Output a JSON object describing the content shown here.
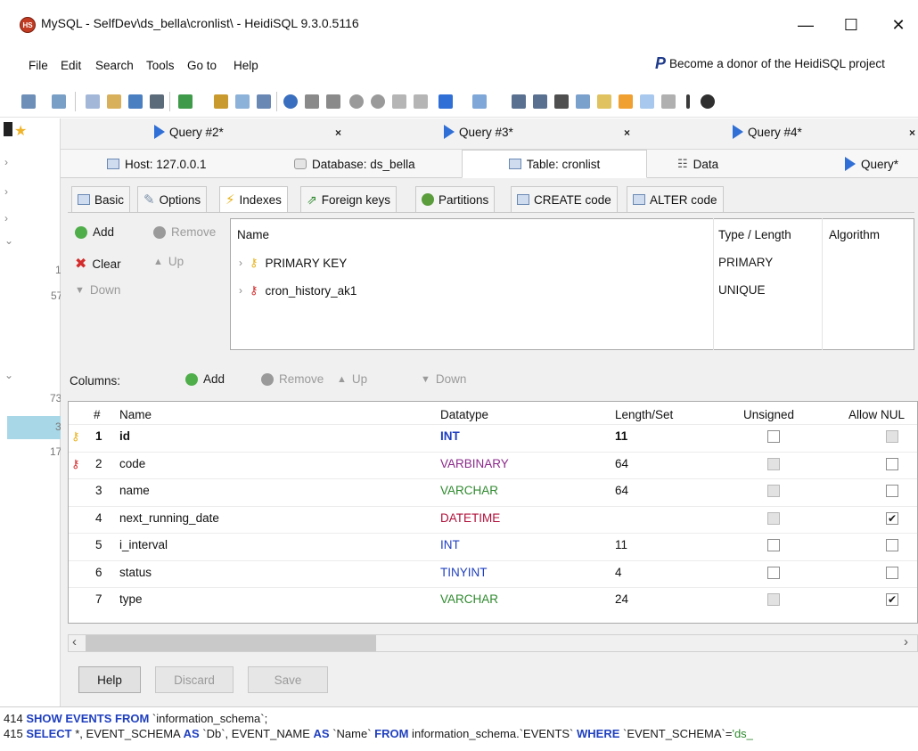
{
  "window": {
    "title": "MySQL - SelfDev\\ds_bella\\cronlist\\ - HeidiSQL 9.3.0.5116",
    "logo_text": "HS"
  },
  "menu": [
    "File",
    "Edit",
    "Search",
    "Tools",
    "Go to",
    "Help"
  ],
  "donor_text": "Become a donor of the HeidiSQL project",
  "query_tabs": [
    {
      "label": "Query #2*"
    },
    {
      "label": "Query #3*"
    },
    {
      "label": "Query #4*"
    }
  ],
  "close_glyph": "×",
  "object_tabs": [
    {
      "label": "Host: 127.0.0.1"
    },
    {
      "label": "Database: ds_bella"
    },
    {
      "label": "Table: cronlist"
    },
    {
      "label": "Data"
    },
    {
      "label": "Query*"
    }
  ],
  "sub_tabs": [
    "Basic",
    "Options",
    "Indexes",
    "Foreign keys",
    "Partitions",
    "CREATE code",
    "ALTER code"
  ],
  "index_buttons": {
    "add": "Add",
    "remove": "Remove",
    "clear": "Clear",
    "up": "Up",
    "down": "Down"
  },
  "index_headers": [
    "Name",
    "Type / Length",
    "Algorithm"
  ],
  "indexes": [
    {
      "name": "PRIMARY KEY",
      "type": "PRIMARY"
    },
    {
      "name": "cron_history_ak1",
      "type": "UNIQUE"
    }
  ],
  "columns_toolbar": {
    "label": "Columns:",
    "add": "Add",
    "remove": "Remove",
    "up": "Up",
    "down": "Down"
  },
  "grid_headers": [
    "#",
    "Name",
    "Datatype",
    "Length/Set",
    "Unsigned",
    "Allow NUL"
  ],
  "columns": [
    {
      "num": "1",
      "name": "id",
      "datatype": "INT",
      "length": "11",
      "unsigned": "empty",
      "allow_null": "disabled"
    },
    {
      "num": "2",
      "name": "code",
      "datatype": "VARBINARY",
      "length": "64",
      "unsigned": "disabled",
      "allow_null": "empty"
    },
    {
      "num": "3",
      "name": "name",
      "datatype": "VARCHAR",
      "length": "64",
      "unsigned": "disabled",
      "allow_null": "empty"
    },
    {
      "num": "4",
      "name": "next_running_date",
      "datatype": "DATETIME",
      "length": "",
      "unsigned": "disabled",
      "allow_null": "checked"
    },
    {
      "num": "5",
      "name": "i_interval",
      "datatype": "INT",
      "length": "11",
      "unsigned": "empty",
      "allow_null": "empty"
    },
    {
      "num": "6",
      "name": "status",
      "datatype": "TINYINT",
      "length": "4",
      "unsigned": "empty",
      "allow_null": "empty"
    },
    {
      "num": "7",
      "name": "type",
      "datatype": "VARCHAR",
      "length": "24",
      "unsigned": "disabled",
      "allow_null": "checked"
    }
  ],
  "buttons": {
    "help": "Help",
    "discard": "Discard",
    "save": "Save"
  },
  "left_strip_numbers": [
    "1",
    "57",
    "73",
    "3",
    "17"
  ],
  "log": [
    {
      "num": "414",
      "kw1": "SHOW EVENTS FROM",
      "rest": " `information_schema`;"
    },
    {
      "num": "415",
      "kw1": "SELECT",
      "p1": " *, EVENT_SCHEMA ",
      "kw2": "AS",
      "p2": " `Db`, EVENT_NAME ",
      "kw3": "AS",
      "p3": " `Name` ",
      "kw4": "FROM",
      "p4": " information_schema.`EVENTS` ",
      "kw5": "WHERE",
      "p5": " `EVENT_SCHEMA`=",
      "str": "'ds_"
    }
  ],
  "glyphs": {
    "check": "✔",
    "scroll_left": "‹",
    "scroll_right": "›",
    "nav": "< >"
  }
}
